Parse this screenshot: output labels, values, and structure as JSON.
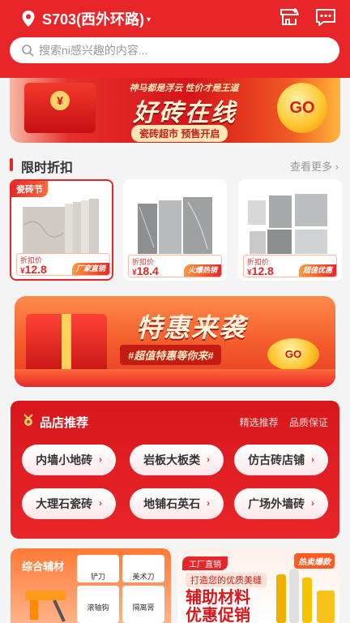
{
  "header": {
    "location": "S703(西外环路)",
    "location_caret": "▾",
    "search_placeholder": "搜索ni感兴趣的内容..."
  },
  "promo": {
    "slogan": "神马都是浮云 性价才是王道",
    "title": "好砖在线",
    "subtitle": "瓷砖超市 预售开启",
    "go": "GO"
  },
  "flash": {
    "title": "限时折扣",
    "more": "查看更多",
    "more_arrow": "›",
    "items": [
      {
        "badge": "瓷砖节",
        "price_label": "折扣价",
        "currency": "¥",
        "price": "12.8",
        "tag": "厂家直销"
      },
      {
        "badge": "",
        "price_label": "折扣价",
        "currency": "¥",
        "price": "18.4",
        "tag": "火爆热销"
      },
      {
        "badge": "",
        "price_label": "折扣价",
        "currency": "¥",
        "price": "12.8",
        "tag": "超值优惠"
      }
    ]
  },
  "sale_banner": {
    "title": "特惠来袭",
    "subtitle": "#超值特惠等你来#",
    "coin": "GO"
  },
  "stores": {
    "title": "品店推荐",
    "links": [
      "精选推荐",
      "品质保证"
    ],
    "arrow": "›",
    "chips": [
      "内墙小地砖",
      "岩板大板类",
      "仿古砖店铺",
      "大理石瓷砖",
      "地铺石英石",
      "广场外墙砖"
    ]
  },
  "bottom": {
    "left_title": "综合辅材",
    "tools": [
      "铲刀",
      "美术刀",
      "滚轴钩",
      "隔离膏"
    ],
    "right_pill": "工厂直销",
    "right_sub": "打造您的优质美缝",
    "right_title_1": "辅助材料",
    "right_title_2": "优惠促销",
    "right_hot": "热卖爆款"
  },
  "colors": {
    "brand": "#e8262a",
    "accent": "#ffc328"
  }
}
